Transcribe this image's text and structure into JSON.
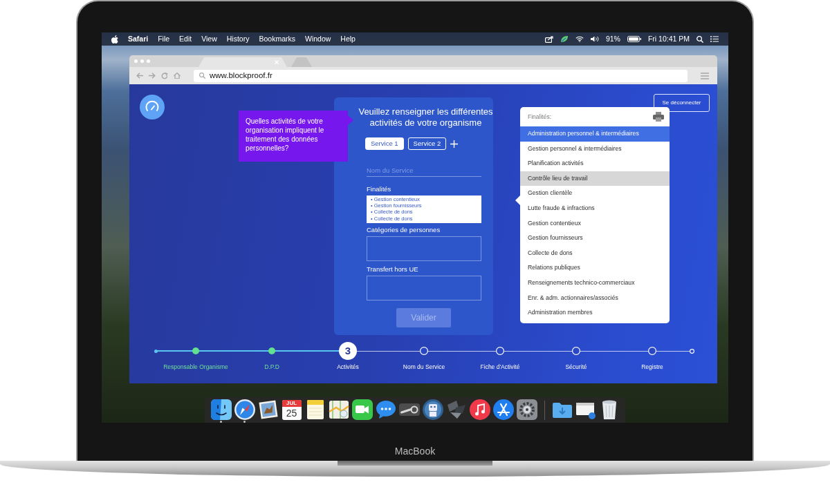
{
  "menu_bar": {
    "app_name": "Safari",
    "menus": [
      "File",
      "Edit",
      "View",
      "History",
      "Bookmarks",
      "Window",
      "Help"
    ],
    "battery": "91%",
    "clock": "Fri 10:41 PM"
  },
  "browser": {
    "tabs": [
      {
        "selected": true
      },
      {
        "selected": false
      }
    ],
    "url": "www.blockproof.fr"
  },
  "page": {
    "question": "Quelles activités de votre organisation impliquent le traitement des données personnelles?",
    "form": {
      "title": "Veuillez renseigner les différentes activités de votre organisme",
      "services": [
        {
          "label": "Service 1",
          "selected": true
        },
        {
          "label": "Service 2",
          "selected": false
        }
      ],
      "name_field": {
        "placeholder": "Nom du Service"
      },
      "purposes": {
        "label": "Finalités",
        "items": [
          "• Gestion contentieux",
          "• Gestion fournisseurs",
          "• Collecte de dons",
          "• Collecte de dons"
        ]
      },
      "categories": {
        "label": "Catégories de personnes"
      },
      "transfer": {
        "label": "Transfert hors UE"
      },
      "submit": {
        "label": "Valider",
        "disabled": true
      }
    },
    "logout_button": "Se déconnecter",
    "purposes_menu": {
      "header": "Finalités:",
      "items": [
        {
          "label": "Administration personnel & intermédiaires",
          "selected": true,
          "hovered": false
        },
        {
          "label": "Gestion personnel & intermédiaires",
          "selected": false,
          "hovered": false
        },
        {
          "label": "Planification activités",
          "selected": false,
          "hovered": false
        },
        {
          "label": "Contrôle lieu de travail",
          "selected": false,
          "hovered": true
        },
        {
          "label": "Gestion clientèle",
          "selected": false,
          "hovered": false
        },
        {
          "label": "Lutte fraude & infractions",
          "selected": false,
          "hovered": false
        },
        {
          "label": "Gestion contentieux",
          "selected": false,
          "hovered": false
        },
        {
          "label": "Gestion fournisseurs",
          "selected": false,
          "hovered": false
        },
        {
          "label": "Collecte de dons",
          "selected": false,
          "hovered": false
        },
        {
          "label": "Relations publiques",
          "selected": false,
          "hovered": false
        },
        {
          "label": "Renseignements technico-commerciaux",
          "selected": false,
          "hovered": false
        },
        {
          "label": "Enr. & adm. actionnaires/associés",
          "selected": false,
          "hovered": false
        },
        {
          "label": "Administration membres",
          "selected": false,
          "hovered": false
        }
      ]
    },
    "steps": [
      {
        "label": "Responsable Organisme",
        "done": true,
        "current": false
      },
      {
        "label": "D.P.D",
        "done": true,
        "current": false
      },
      {
        "label": "Activités",
        "done": false,
        "current": true,
        "number": "3"
      },
      {
        "label": "Nom du Service",
        "done": false,
        "current": false
      },
      {
        "label": "Fiche d'Activité",
        "done": false,
        "current": false
      },
      {
        "label": "Sécurité",
        "done": false,
        "current": false
      },
      {
        "label": "Registre",
        "done": false,
        "current": false
      }
    ]
  },
  "dock": {
    "apps": [
      {
        "kind": "face",
        "running": true
      },
      {
        "kind": "compass",
        "running": true
      },
      {
        "kind": "picture",
        "running": false
      },
      {
        "kind": "calendar",
        "running": false,
        "month": "JUL",
        "day": "25"
      },
      {
        "kind": "notepad",
        "running": false
      },
      {
        "kind": "map",
        "running": false
      },
      {
        "kind": "camera",
        "running": false
      },
      {
        "kind": "bubble",
        "running": false
      },
      {
        "kind": "piston",
        "running": false
      },
      {
        "kind": "robot",
        "running": false
      },
      {
        "kind": "shapes",
        "running": false
      },
      {
        "kind": "music",
        "running": false
      },
      {
        "kind": "sticks",
        "running": false
      },
      {
        "kind": "gear",
        "running": false
      }
    ],
    "stacks": [
      {
        "kind": "folder",
        "running": false
      },
      {
        "kind": "window",
        "running": false
      },
      {
        "kind": "trash",
        "running": false
      }
    ]
  },
  "device": {
    "label": "MacBook"
  }
}
